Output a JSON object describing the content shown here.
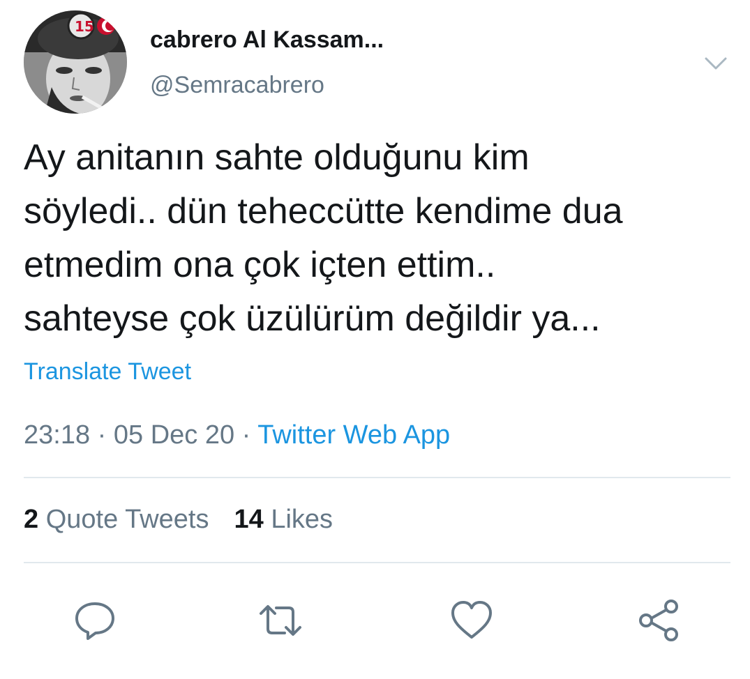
{
  "user": {
    "display_name": "cabrero Al Kassam...",
    "handle": "@Semracabrero",
    "avatar_badge": "15"
  },
  "tweet": {
    "text_lines": [
      "Ay anitanın sahte olduğunu kim",
      "söyledi.. dün teheccütte kendime dua",
      "etmedim ona çok içten ettim..",
      "sahteyse çok üzülürüm değildir ya..."
    ],
    "translate_label": "Translate Tweet",
    "time": "23:18",
    "date": "05 Dec 20",
    "separator": "·",
    "source": "Twitter Web App"
  },
  "stats": {
    "quote_tweets_count": "2",
    "quote_tweets_label": "Quote Tweets",
    "likes_count": "14",
    "likes_label": "Likes"
  },
  "actions": {
    "reply": "reply-icon",
    "retweet": "retweet-icon",
    "like": "heart-icon",
    "share": "share-icon",
    "more": "chevron-down-icon"
  },
  "colors": {
    "text": "#14171a",
    "secondary": "#657786",
    "link": "#1b95e0",
    "divider": "#e1e8ed"
  }
}
